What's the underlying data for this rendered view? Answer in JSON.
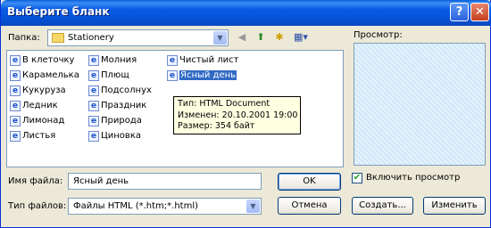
{
  "window": {
    "title": "Выберите бланк",
    "help_label": "?",
    "close_label": "✕"
  },
  "folder": {
    "label": "Папка:",
    "value": "Stationery"
  },
  "icons": {
    "folder": "folder-icon",
    "back": "back-icon",
    "up": "up-folder-icon",
    "new_folder": "new-folder-icon",
    "view": "view-menu-icon",
    "file": "ie-html-icon"
  },
  "preview": {
    "label": "Просмотр:"
  },
  "files": [
    "В клеточку",
    "Карамелька",
    "Кукуруза",
    "Ледник",
    "Лимонад",
    "Листья",
    "Молния",
    "Плющ",
    "Подсолнух",
    "Праздник",
    "Природа",
    "Циновка",
    "Чистый лист",
    "Ясный день"
  ],
  "selected_file": "Ясный день",
  "tooltip": {
    "line1": "Тип: HTML Document",
    "line2": "Изменен: 20.10.2001 19:00",
    "line3": "Размер: 354 байт"
  },
  "filename": {
    "label": "Имя файла:",
    "value": "Ясный день"
  },
  "filetype": {
    "label": "Тип файлов:",
    "value": "Файлы HTML (*.htm;*.html)"
  },
  "buttons": {
    "ok": "OK",
    "cancel": "Отмена",
    "create": "Создать...",
    "edit": "Изменить"
  },
  "enable_preview": {
    "label": "Включить просмотр",
    "checked": true
  }
}
